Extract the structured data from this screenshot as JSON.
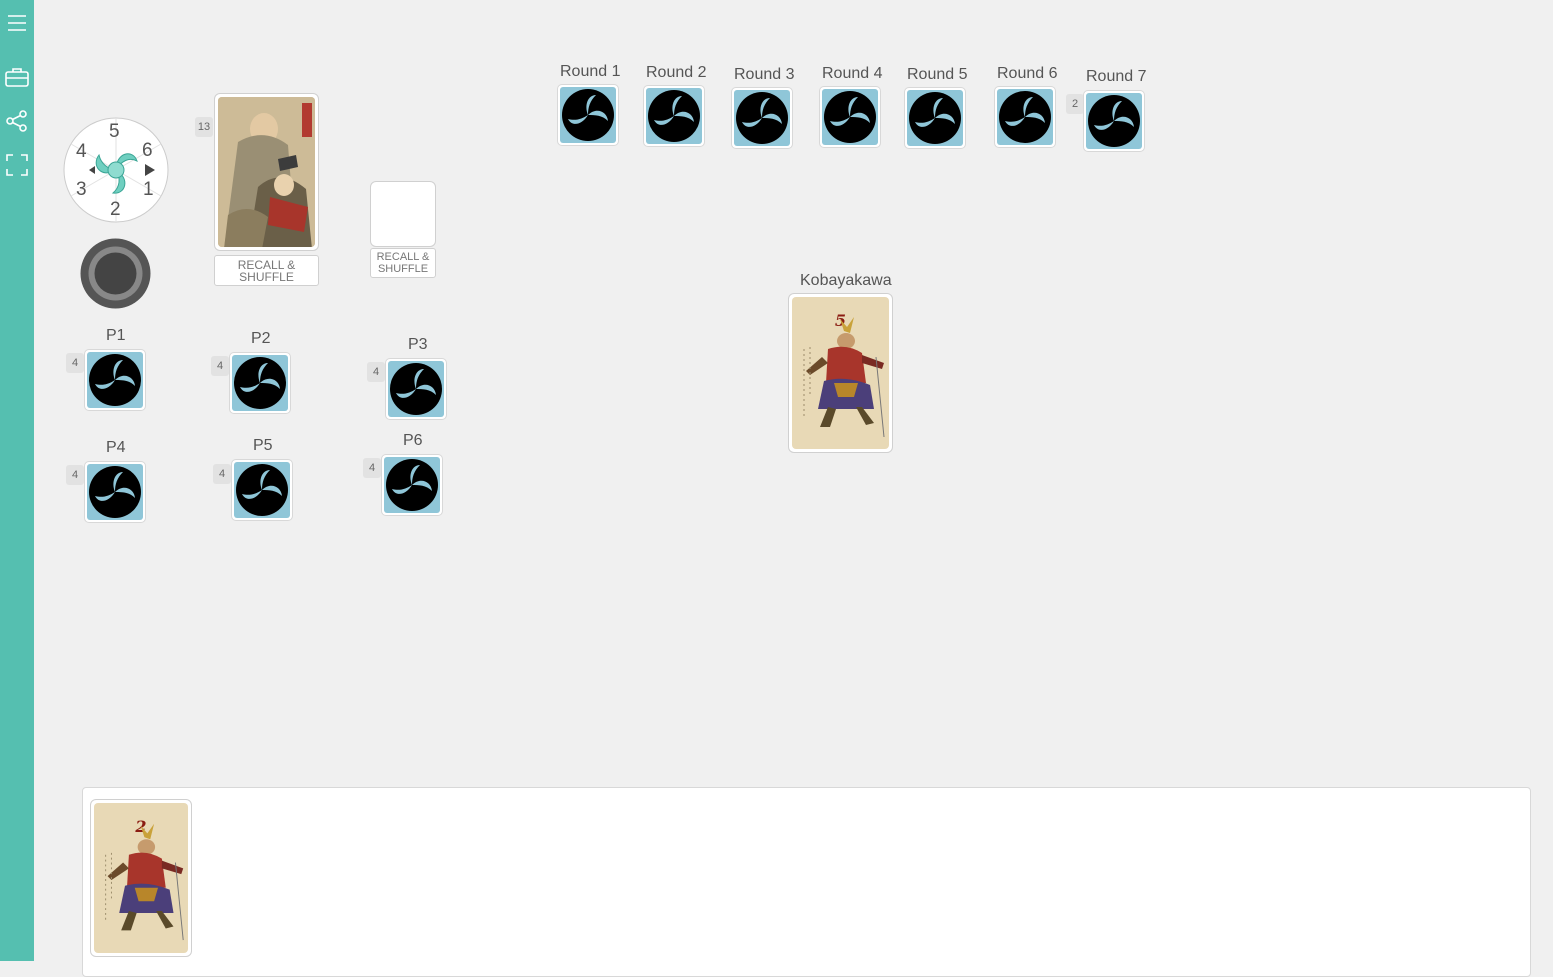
{
  "sidebar": {
    "items": [
      {
        "icon": "menu-icon"
      },
      {
        "icon": "briefcase-icon"
      },
      {
        "icon": "share-icon"
      },
      {
        "icon": "fullscreen-icon"
      }
    ]
  },
  "dice_wheel": {
    "numbers": [
      "5",
      "6",
      "1",
      "2",
      "3",
      "4"
    ],
    "accent": "#55bfb0"
  },
  "deck": {
    "count": "13",
    "recall_label": "RECALL & SHUFFLE"
  },
  "discard": {
    "recall_label": "RECALL & SHUFFLE"
  },
  "rounds": [
    {
      "label": "Round 1",
      "count": ""
    },
    {
      "label": "Round 2",
      "count": ""
    },
    {
      "label": "Round 3",
      "count": ""
    },
    {
      "label": "Round 4",
      "count": ""
    },
    {
      "label": "Round 5",
      "count": ""
    },
    {
      "label": "Round 6",
      "count": ""
    },
    {
      "label": "Round 7",
      "count": "2"
    }
  ],
  "players": [
    {
      "label": "P1",
      "count": "4"
    },
    {
      "label": "P2",
      "count": "4"
    },
    {
      "label": "P3",
      "count": "4"
    },
    {
      "label": "P4",
      "count": "4"
    },
    {
      "label": "P5",
      "count": "4"
    },
    {
      "label": "P6",
      "count": "4"
    }
  ],
  "kobayakawa": {
    "label": "Kobayakawa",
    "card_value": "5"
  },
  "hand": {
    "cards": [
      {
        "value": "2"
      }
    ]
  },
  "colors": {
    "sidebar": "#55bfb0",
    "chip_bg": "#8fc6d8",
    "card_bg": "#e8d9b6",
    "card_number": "#8b1c12"
  }
}
